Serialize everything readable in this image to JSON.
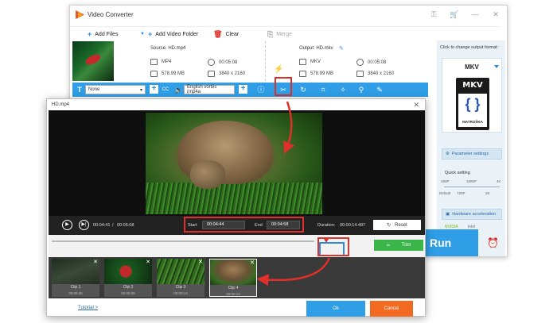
{
  "app": {
    "title": "Video Converter"
  },
  "toolbar": {
    "add_files": "Add Files",
    "add_video_folder": "Add Video Folder",
    "clear": "Clear",
    "merge": "Merge"
  },
  "file": {
    "source": "Source: HD.mp4",
    "output": "Output: HD.mkv",
    "src_format": "MP4",
    "src_duration": "00:05:08",
    "src_size": "578.99 MB",
    "src_resolution": "3840 x 2160",
    "out_format": "MKV",
    "out_duration": "00:05:08",
    "out_size": "578.99 MB",
    "out_resolution": "3840 x 2160"
  },
  "edit_bar": {
    "subtitle": "None",
    "audio": "English vorbis (mp4a"
  },
  "right_panel": {
    "hint": "Click to change output format:",
    "format": "MKV",
    "logo_text": "MKV",
    "logo_sub": "MATROŠKA",
    "parameter_settings": "Parameter settings",
    "quick_setting": "Quick setting",
    "q_labels": [
      "480P",
      "1080P",
      "4K"
    ],
    "q_labels_low": [
      "Default",
      "720P",
      "2K"
    ],
    "hw_accel": "Hardware acceleration",
    "nvidia": "NVIDIA",
    "intel": "Intel"
  },
  "run": "Run",
  "dialog": {
    "title": "HD.mp4",
    "current_time": "00:04:41",
    "total_time": "00:05:08",
    "start_label": "Start",
    "start_value": "00:04:44",
    "end_label": "End",
    "end_value": "00:04:58",
    "duration_label": "Duration:",
    "duration_value": "00:00:14.487",
    "reset": "Reset",
    "trim": "Trim",
    "clips": [
      {
        "name": "Clip 1",
        "time": "00:00:45"
      },
      {
        "name": "Clip 2",
        "time": "00:00:38"
      },
      {
        "name": "Clip 3",
        "time": "00:00:14"
      },
      {
        "name": "Clip 4",
        "time": "00:00:14"
      }
    ],
    "tutorial": "Tutorial >",
    "ok": "Ok",
    "cancel": "Cancel"
  },
  "colors": {
    "accent": "#2f9ee6",
    "highlight": "#e0302a",
    "trim": "#3bb54a",
    "cancel": "#f26a22"
  }
}
